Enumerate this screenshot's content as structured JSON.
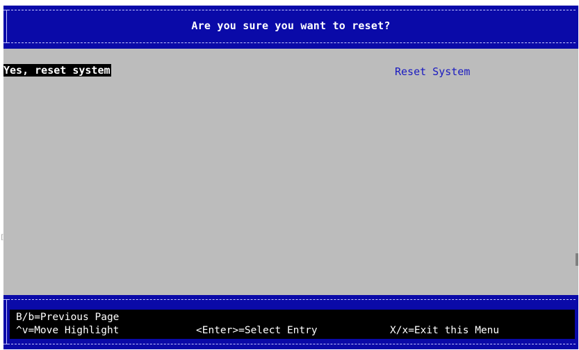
{
  "dialog": {
    "title": "Are you sure you want to reset?"
  },
  "menu": {
    "option": "Yes, reset system",
    "help": "Reset System"
  },
  "footer": {
    "prev_page": "B/b=Previous Page",
    "move_highlight": "^v=Move Highlight",
    "select_entry": "<Enter>=Select Entry",
    "exit_menu": "X/x=Exit this Menu"
  },
  "colors": {
    "frame_blue": "#0a0aa8",
    "body_gray": "#bcbcbc",
    "highlight_bg": "#000000",
    "help_text": "#1a1ac0"
  }
}
